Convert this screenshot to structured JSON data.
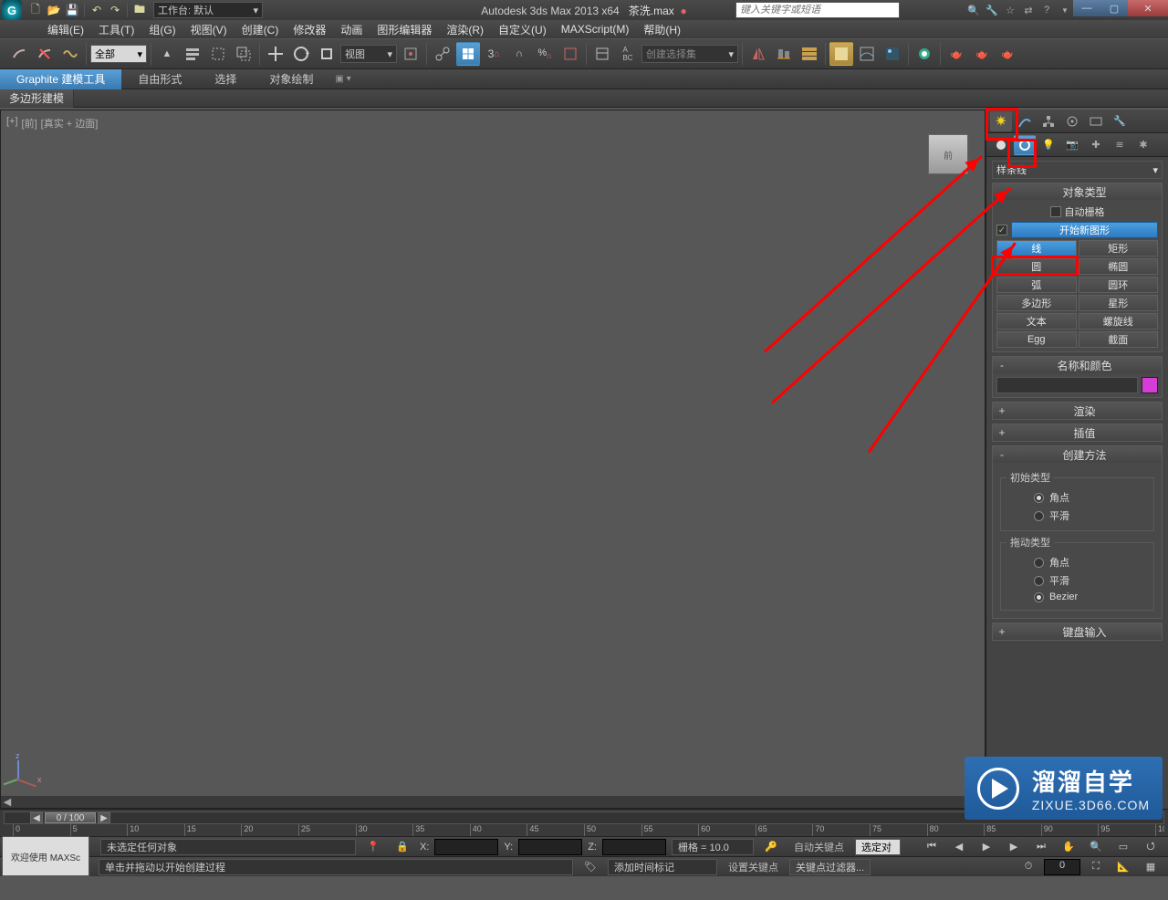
{
  "titlebar": {
    "workspace_label": "工作台: 默认",
    "app_title": "Autodesk 3ds Max  2013 x64",
    "filename": "茶洗.max",
    "search_placeholder": "键入关键字或短语"
  },
  "menu": {
    "edit": "编辑(E)",
    "tools": "工具(T)",
    "group": "组(G)",
    "views": "视图(V)",
    "create": "创建(C)",
    "modifiers": "修改器",
    "animation": "动画",
    "graph": "图形编辑器",
    "render": "渲染(R)",
    "customize": "自定义(U)",
    "maxscript": "MAXScript(M)",
    "help": "帮助(H)"
  },
  "toolbar": {
    "filter_all": "全部",
    "view_combo": "视图",
    "named_sel": "创建选择集"
  },
  "ribbon": {
    "tabs": {
      "graphite": "Graphite 建模工具",
      "freeform": "自由形式",
      "selection": "选择",
      "objpaint": "对象绘制"
    },
    "sub_poly": "多边形建模"
  },
  "viewport": {
    "label_plus": "[+]",
    "label_view": "[前]",
    "label_shade": "[真实 + 边面]",
    "cube_face": "前"
  },
  "cmdpanel": {
    "dropdown": "样条线",
    "rollouts": {
      "obj_type": "对象类型",
      "auto_grid": "自动栅格",
      "start_shape": "开始新图形",
      "name_color": "名称和颜色",
      "render": "渲染",
      "interp": "插值",
      "create_method": "创建方法",
      "kbd": "键盘输入"
    },
    "shapes": {
      "line": "线",
      "rectangle": "矩形",
      "circle": "圆",
      "ellipse": "椭圆",
      "arc": "弧",
      "donut": "圆环",
      "ngon": "多边形",
      "star": "星形",
      "text": "文本",
      "helix": "螺旋线",
      "egg": "Egg",
      "section": "截面"
    },
    "create_method": {
      "initial_legend": "初始类型",
      "drag_legend": "拖动类型",
      "corner": "角点",
      "smooth": "平滑",
      "bezier": "Bezier"
    }
  },
  "timeline": {
    "slider_label": "0 / 100"
  },
  "status": {
    "no_sel": "未选定任何对象",
    "prompt": "单击并拖动以开始创建过程",
    "x": "X:",
    "y": "Y:",
    "z": "Z:",
    "grid": "栅格 = 10.0",
    "add_time_tag": "添加时间标记",
    "auto_key": "自动关键点",
    "set_key": "设置关键点",
    "sel_set_label": "选定对",
    "key_filters": "关键点过滤器...",
    "welcome": "欢迎使用  MAXSc"
  },
  "watermark": {
    "line1": "溜溜自学",
    "line2": "ZIXUE.3D66.COM"
  }
}
